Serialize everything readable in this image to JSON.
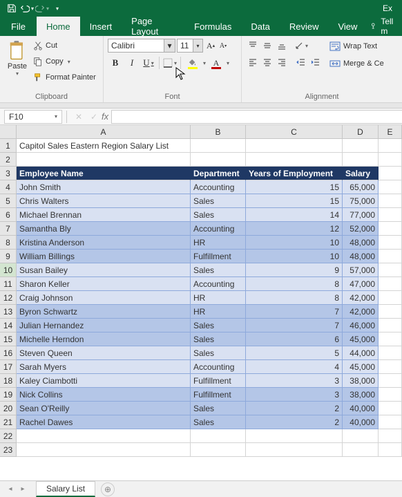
{
  "app_title": "Ex",
  "qat": {
    "save": "save-icon",
    "undo": "undo-icon",
    "redo": "redo-icon"
  },
  "tabs": {
    "file": "File",
    "home": "Home",
    "insert": "Insert",
    "page_layout": "Page Layout",
    "formulas": "Formulas",
    "data": "Data",
    "review": "Review",
    "view": "View",
    "tell_me": "Tell m"
  },
  "clipboard": {
    "paste": "Paste",
    "cut": "Cut",
    "copy": "Copy",
    "format_painter": "Format Painter",
    "group_label": "Clipboard"
  },
  "font": {
    "name": "Calibri",
    "size": "11",
    "group_label": "Font",
    "fill_color": "#ffff00",
    "font_color": "#c00000"
  },
  "alignment": {
    "wrap": "Wrap Text",
    "merge": "Merge & Ce",
    "group_label": "Alignment"
  },
  "name_box": "F10",
  "columns": [
    "A",
    "B",
    "C",
    "D",
    "E"
  ],
  "title_cell": "Capitol Sales Eastern Region Salary List",
  "headers": {
    "a": "Employee Name",
    "b": "Department",
    "c": "Years of Employment",
    "d": "Salary"
  },
  "rows": [
    {
      "name": "John Smith",
      "dept": "Accounting",
      "years": "15",
      "salary": "65,000",
      "shade": "light"
    },
    {
      "name": "Chris Walters",
      "dept": "Sales",
      "years": "15",
      "salary": "75,000",
      "shade": "light"
    },
    {
      "name": "Michael Brennan",
      "dept": "Sales",
      "years": "14",
      "salary": "77,000",
      "shade": "light"
    },
    {
      "name": "Samantha Bly",
      "dept": "Accounting",
      "years": "12",
      "salary": "52,000",
      "shade": "dark"
    },
    {
      "name": "Kristina Anderson",
      "dept": "HR",
      "years": "10",
      "salary": "48,000",
      "shade": "dark"
    },
    {
      "name": "William Billings",
      "dept": "Fulfillment",
      "years": "10",
      "salary": "48,000",
      "shade": "dark"
    },
    {
      "name": "Susan Bailey",
      "dept": "Sales",
      "years": "9",
      "salary": "57,000",
      "shade": "light"
    },
    {
      "name": "Sharon Keller",
      "dept": "Accounting",
      "years": "8",
      "salary": "47,000",
      "shade": "light"
    },
    {
      "name": "Craig Johnson",
      "dept": "HR",
      "years": "8",
      "salary": "42,000",
      "shade": "light"
    },
    {
      "name": "Byron Schwartz",
      "dept": "HR",
      "years": "7",
      "salary": "42,000",
      "shade": "dark"
    },
    {
      "name": "Julian Hernandez",
      "dept": "Sales",
      "years": "7",
      "salary": "46,000",
      "shade": "dark"
    },
    {
      "name": "Michelle Herndon",
      "dept": "Sales",
      "years": "6",
      "salary": "45,000",
      "shade": "dark"
    },
    {
      "name": "Steven Queen",
      "dept": "Sales",
      "years": "5",
      "salary": "44,000",
      "shade": "light"
    },
    {
      "name": "Sarah Myers",
      "dept": "Accounting",
      "years": "4",
      "salary": "45,000",
      "shade": "light"
    },
    {
      "name": "Kaley Ciambotti",
      "dept": "Fulfillment",
      "years": "3",
      "salary": "38,000",
      "shade": "light"
    },
    {
      "name": "Nick Collins",
      "dept": "Fulfillment",
      "years": "3",
      "salary": "38,000",
      "shade": "dark"
    },
    {
      "name": "Sean O'Reilly",
      "dept": "Sales",
      "years": "2",
      "salary": "40,000",
      "shade": "dark"
    },
    {
      "name": "Rachel Dawes",
      "dept": "Sales",
      "years": "2",
      "salary": "40,000",
      "shade": "dark"
    }
  ],
  "sheet_tab": "Salary List"
}
